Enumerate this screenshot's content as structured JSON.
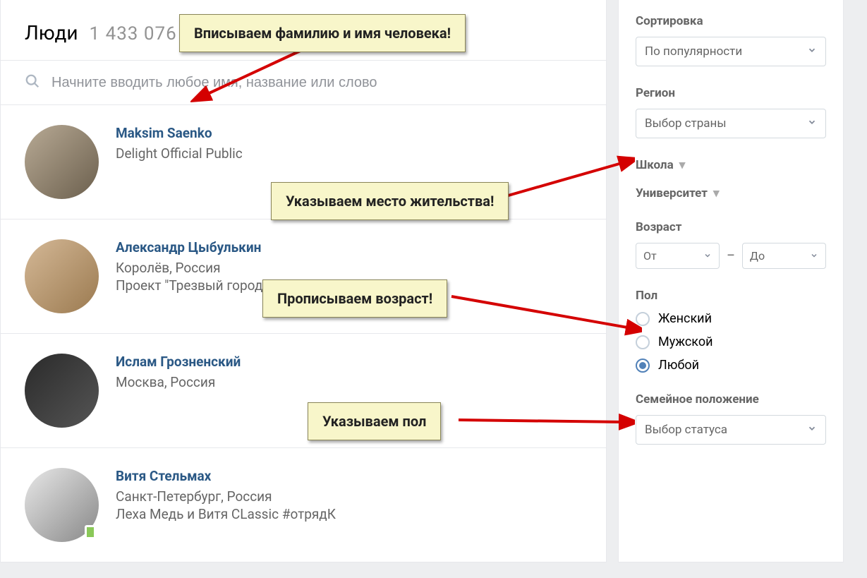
{
  "header": {
    "title": "Люди",
    "count": "1 433 076"
  },
  "search": {
    "placeholder": "Начните вводить любое имя, название или слово"
  },
  "people": [
    {
      "name": "Maksim Saenko",
      "detail1": "Delight Official Public",
      "detail2": ""
    },
    {
      "name": "Александр Цыбулькин",
      "detail1": "Королёв, Россия",
      "detail2": "Проект \"Трезвый город\" г. Королев"
    },
    {
      "name": "Ислам Грозненский",
      "detail1": "Москва, Россия",
      "detail2": ""
    },
    {
      "name": "Витя Стельмах",
      "detail1": "Санкт-Петербург, Россия",
      "detail2": "Леха Медь и Витя CLassic #отрядК"
    }
  ],
  "sidebar": {
    "sort_label": "Сортировка",
    "sort_value": "По популярности",
    "region_label": "Регион",
    "region_value": "Выбор страны",
    "school_label": "Школа",
    "university_label": "Университет",
    "age_label": "Возраст",
    "age_from": "От",
    "age_to": "До",
    "gender_label": "Пол",
    "gender_options": {
      "female": "Женский",
      "male": "Мужской",
      "any": "Любой"
    },
    "marital_label": "Семейное положение",
    "marital_value": "Выбор статуса"
  },
  "callouts": {
    "c1": "Вписываем фамилию и имя человека!",
    "c2": "Указываем место жительства!",
    "c3": "Прописываем возраст!",
    "c4": "Указываем пол"
  }
}
